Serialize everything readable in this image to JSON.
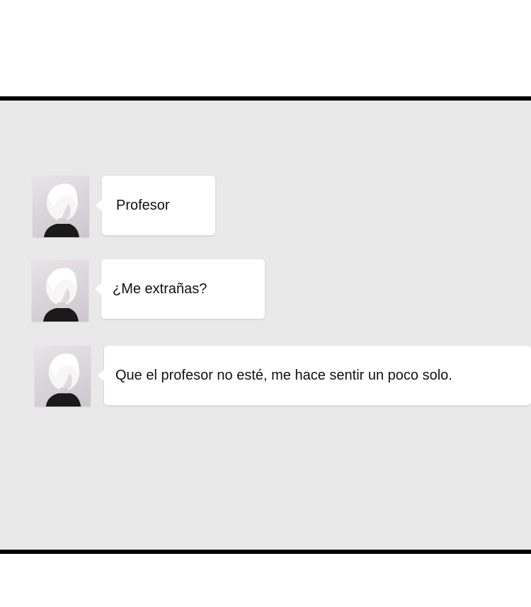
{
  "messages": [
    {
      "text": "Profesor",
      "avatar_icon": "white-haired-character-avatar-icon"
    },
    {
      "text": "¿Me extrañas?",
      "avatar_icon": "white-haired-character-avatar-icon"
    },
    {
      "text": "Que el profesor no esté, me hace sentir un poco solo.",
      "avatar_icon": "white-haired-character-avatar-icon"
    }
  ],
  "colors": {
    "panel_background": "#e9e9e9",
    "panel_border": "#000000",
    "bubble_background": "#ffffff",
    "text": "#111111"
  }
}
